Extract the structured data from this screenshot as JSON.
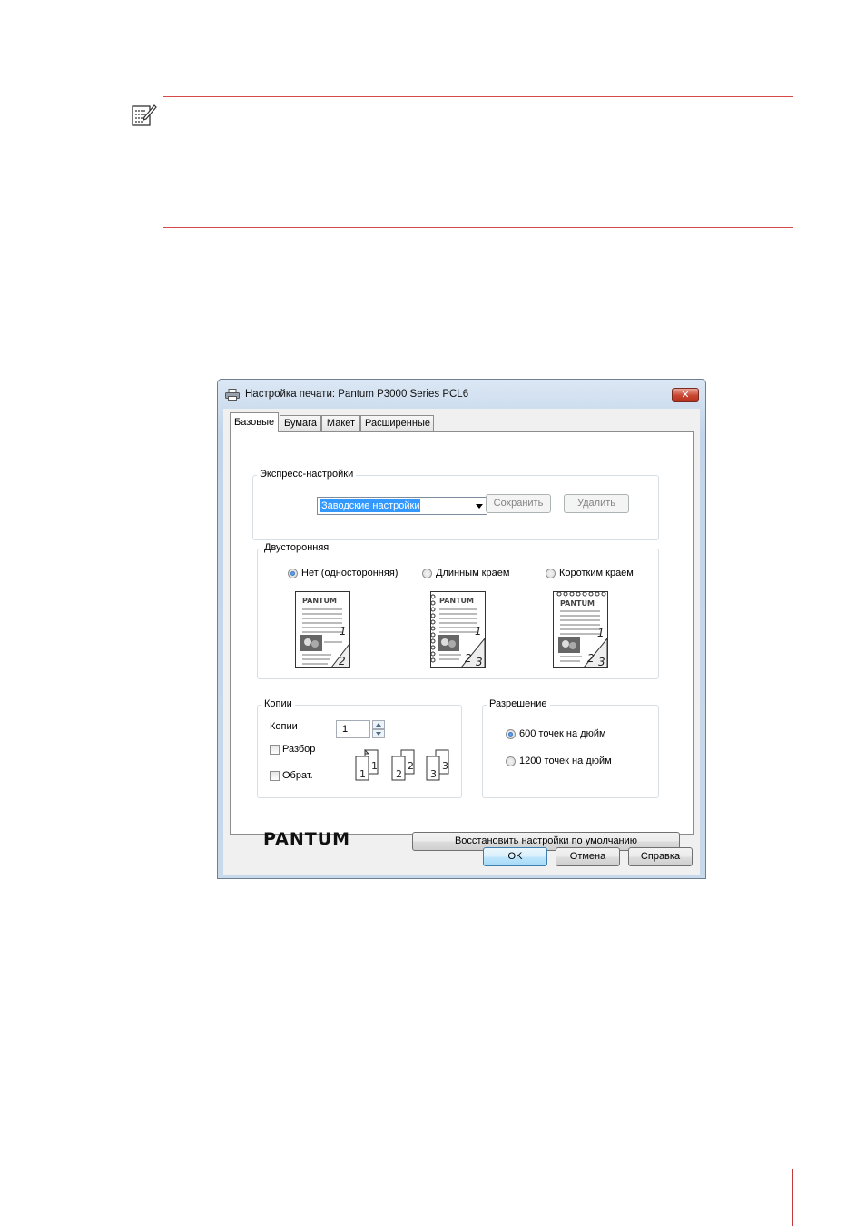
{
  "dialog": {
    "title": "Настройка печати: Pantum P3000 Series PCL6",
    "close_glyph": "✕",
    "tabs": [
      {
        "label": "Базовые",
        "active": true
      },
      {
        "label": "Бумага",
        "active": false
      },
      {
        "label": "Макет",
        "active": false
      },
      {
        "label": "Расширенные",
        "active": false
      }
    ],
    "express": {
      "group_label": "Экспресс-настройки",
      "selected_preset": "Заводские настройки",
      "save_label": "Сохранить",
      "delete_label": "Удалить"
    },
    "duplex": {
      "group_label": "Двусторонняя",
      "options": [
        {
          "label": "Нет (односторонняя)",
          "selected": true
        },
        {
          "label": "Длинным краем",
          "selected": false
        },
        {
          "label": "Коротким краем",
          "selected": false
        }
      ],
      "brand_on_page": "PANTUM",
      "page_numbers": [
        "1",
        "2",
        "3"
      ]
    },
    "copies": {
      "group_label": "Копии",
      "copies_label": "Копии",
      "copies_value": "1",
      "collate_label": "Разбор",
      "collate_checked": false,
      "reverse_label": "Обрат.",
      "reverse_checked": false
    },
    "resolution": {
      "group_label": "Разрешение",
      "options": [
        {
          "label": "600 точек на дюйм",
          "selected": true
        },
        {
          "label": "1200 точек на дюйм",
          "selected": false
        }
      ]
    },
    "logo_text": "PANTUM",
    "restore_label": "Восстановить настройки по умолчанию",
    "ok_label": "OK",
    "cancel_label": "Отмена",
    "help_label": "Справка"
  },
  "icons": [
    "note-icon",
    "printer-icon",
    "close-icon",
    "dropdown-arrow-icon",
    "spin-up-icon",
    "spin-down-icon"
  ],
  "colors": {
    "rule": "#d84a4a",
    "selection": "#3399ff",
    "title_bar": "#c3d5ea"
  }
}
